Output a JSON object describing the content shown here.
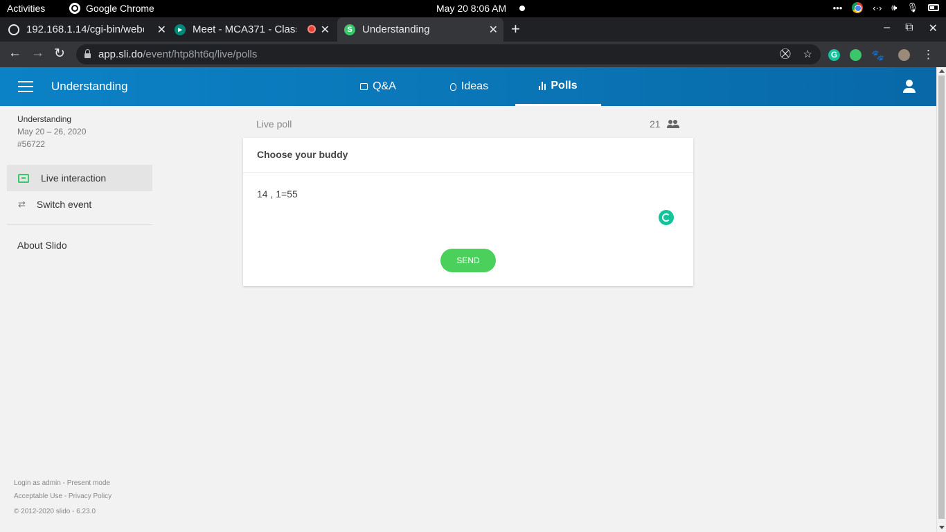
{
  "system_bar": {
    "activities": "Activities",
    "app_name": "Google Chrome",
    "clock": "May 20   8:06 AM"
  },
  "browser": {
    "tabs": [
      {
        "title": "192.168.1.14/cgi-bin/webc",
        "active": false
      },
      {
        "title": "Meet - MCA371 - Class",
        "active": false
      },
      {
        "title": "Understanding",
        "active": true
      }
    ],
    "url_host": "app.sli.do",
    "url_path": "/event/htp8ht6q/live/polls"
  },
  "header": {
    "event_name": "Understanding",
    "nav": [
      {
        "label": "Q&A",
        "active": false
      },
      {
        "label": "Ideas",
        "active": false
      },
      {
        "label": "Polls",
        "active": true
      }
    ]
  },
  "sidebar": {
    "event_title": "Understanding",
    "event_dates": "May 20 – 26, 2020",
    "event_code": "#56722",
    "items": [
      {
        "label": "Live interaction",
        "icon": "chat-icon",
        "active": true
      },
      {
        "label": "Switch event",
        "icon": "swap-icon",
        "active": false
      }
    ],
    "about": "About Slido",
    "footer": {
      "line1": "Login as admin - Present mode",
      "line2": "Acceptable Use - Privacy Policy",
      "line3": "© 2012-2020 slido - 6.23.0"
    }
  },
  "poll": {
    "label": "Live poll",
    "participants": "21",
    "question": "Choose your buddy",
    "answer_value": "14 , 1=55",
    "send_label": "SEND"
  },
  "colors": {
    "header_blue": "#0a74b4",
    "accent_green": "#4cd05c",
    "grammarly_teal": "#15c39a"
  }
}
